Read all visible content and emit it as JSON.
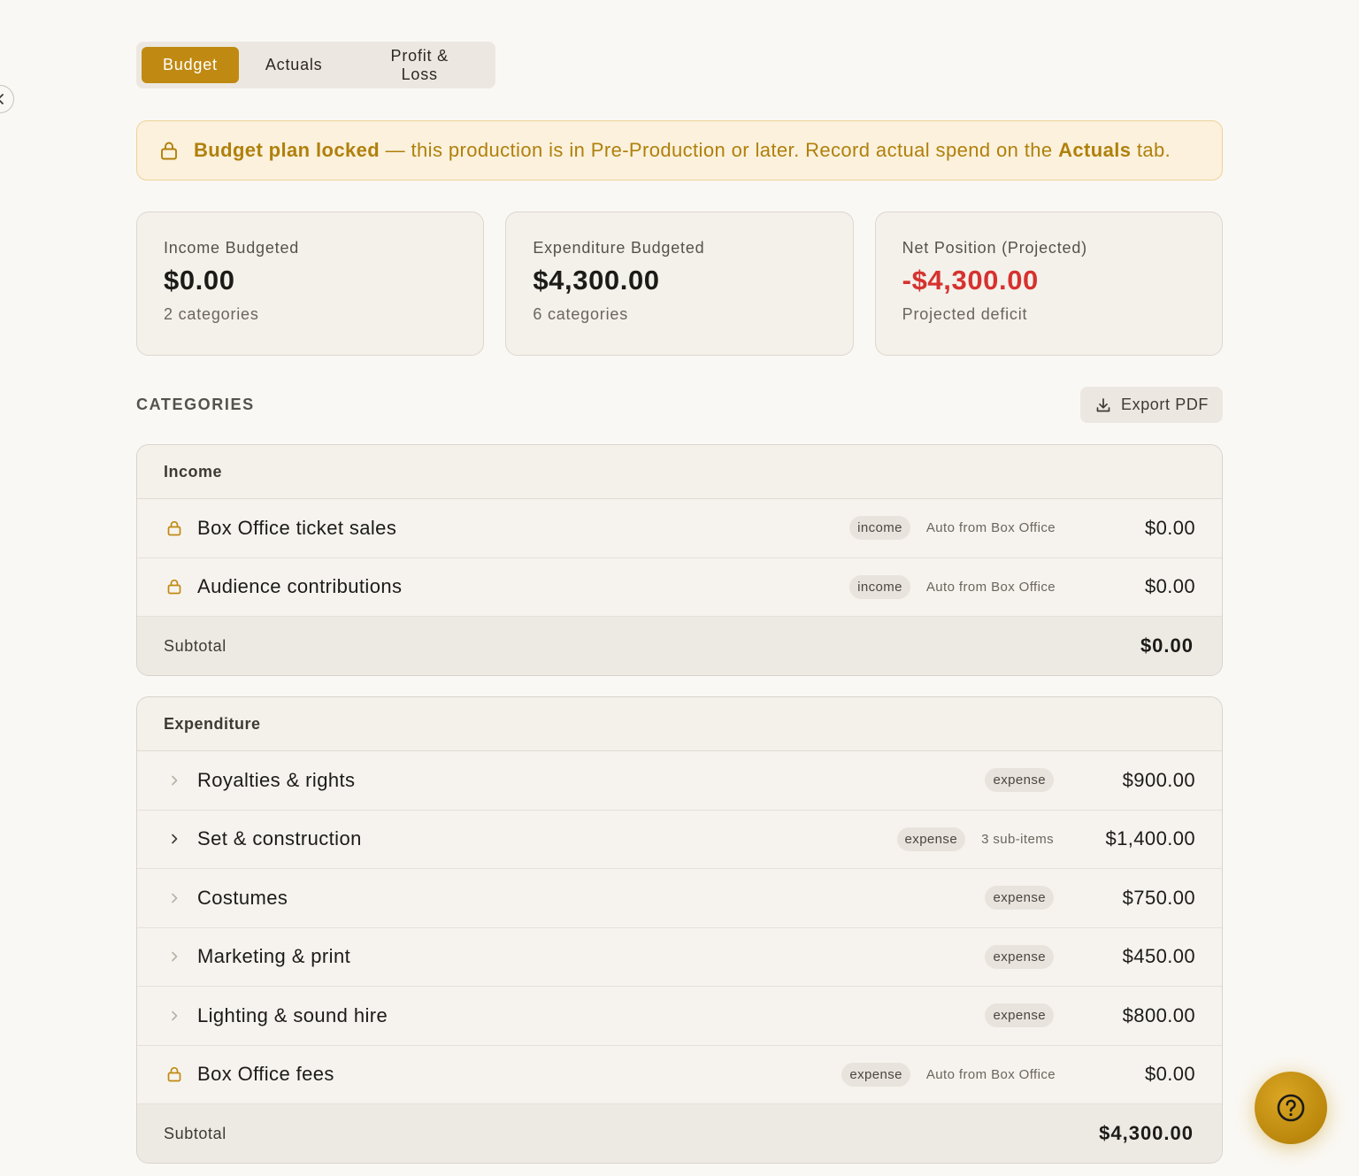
{
  "tabs": [
    {
      "label": "Budget",
      "active": true
    },
    {
      "label": "Actuals",
      "active": false
    },
    {
      "label": "Profit & Loss",
      "active": false
    }
  ],
  "banner": {
    "strong": "Budget plan locked",
    "text": " — this production is in Pre-Production or later. Record actual spend on the ",
    "link": "Actuals",
    "suffix": " tab."
  },
  "summary": {
    "income": {
      "label": "Income Budgeted",
      "value": "$0.00",
      "sub": "2 categories"
    },
    "expenditure": {
      "label": "Expenditure Budgeted",
      "value": "$4,300.00",
      "sub": "6 categories"
    },
    "net": {
      "label": "Net Position (Projected)",
      "value": "-$4,300.00",
      "sub": "Projected deficit"
    }
  },
  "categories_title": "CATEGORIES",
  "export_label": "Export PDF",
  "income_group": {
    "title": "Income",
    "rows": [
      {
        "name": "Box Office ticket sales",
        "badge": "income",
        "note": "Auto from Box Office",
        "amount": "$0.00"
      },
      {
        "name": "Audience contributions",
        "badge": "income",
        "note": "Auto from Box Office",
        "amount": "$0.00"
      }
    ],
    "subtotal_label": "Subtotal",
    "subtotal": "$0.00"
  },
  "expenditure_group": {
    "title": "Expenditure",
    "rows": [
      {
        "name": "Royalties & rights",
        "badge": "expense",
        "note": "",
        "amount": "$900.00"
      },
      {
        "name": "Set & construction",
        "badge": "expense",
        "note": "3 sub-items",
        "amount": "$1,400.00"
      },
      {
        "name": "Costumes",
        "badge": "expense",
        "note": "",
        "amount": "$750.00"
      },
      {
        "name": "Marketing & print",
        "badge": "expense",
        "note": "",
        "amount": "$450.00"
      },
      {
        "name": "Lighting & sound hire",
        "badge": "expense",
        "note": "",
        "amount": "$800.00"
      },
      {
        "name": "Box Office fees",
        "badge": "expense",
        "note": "Auto from Box Office",
        "amount": "$0.00"
      }
    ],
    "subtotal_label": "Subtotal",
    "subtotal": "$4,300.00"
  },
  "colors": {
    "accent": "#c08a12",
    "negative": "#d6322f",
    "banner_bg": "#fbf1dc"
  },
  "icons": {
    "lock": "lock-icon",
    "chevron": "chevron-right-icon",
    "download": "download-icon",
    "help": "help-circle-icon",
    "collapse": "chevron-left-icon"
  }
}
